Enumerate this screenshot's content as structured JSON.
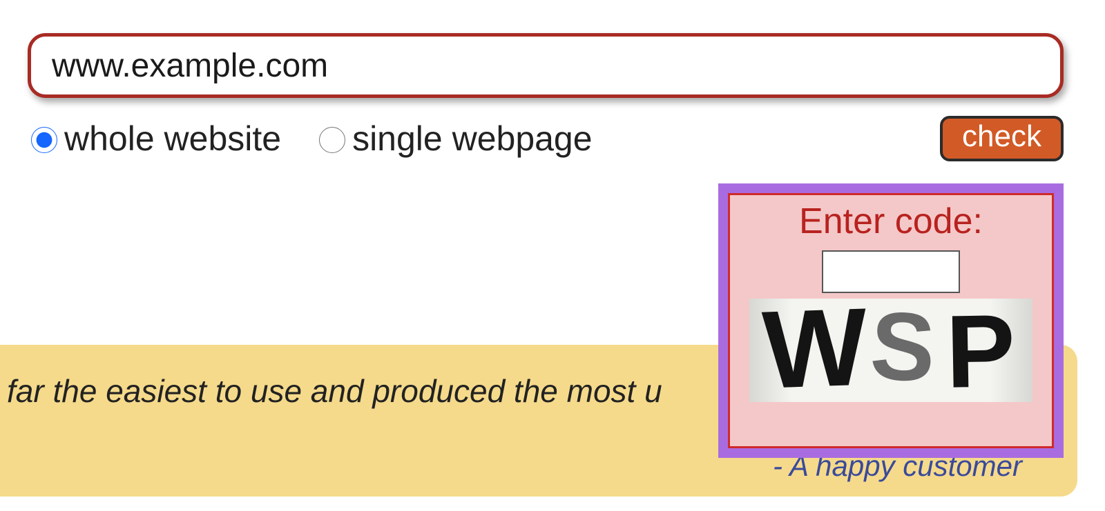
{
  "url_input": {
    "value": "www.example.com",
    "placeholder": ""
  },
  "scope": {
    "whole_label": "whole website",
    "single_label": "single webpage",
    "selected": "whole"
  },
  "check_button": {
    "label": "check"
  },
  "testimonial": {
    "quote": "far the easiest to use and produced the most u",
    "attribution": "- A happy customer"
  },
  "captcha": {
    "title": "Enter code:",
    "input_value": "",
    "code": "WSP"
  },
  "colors": {
    "input_border": "#a82b24",
    "check_bg": "#d25a26",
    "captcha_outer": "#a96ce0",
    "captcha_inner_bg": "#f4c8c8",
    "captcha_inner_border": "#cf2a2a",
    "testimonial_bg": "#f5da8b"
  }
}
